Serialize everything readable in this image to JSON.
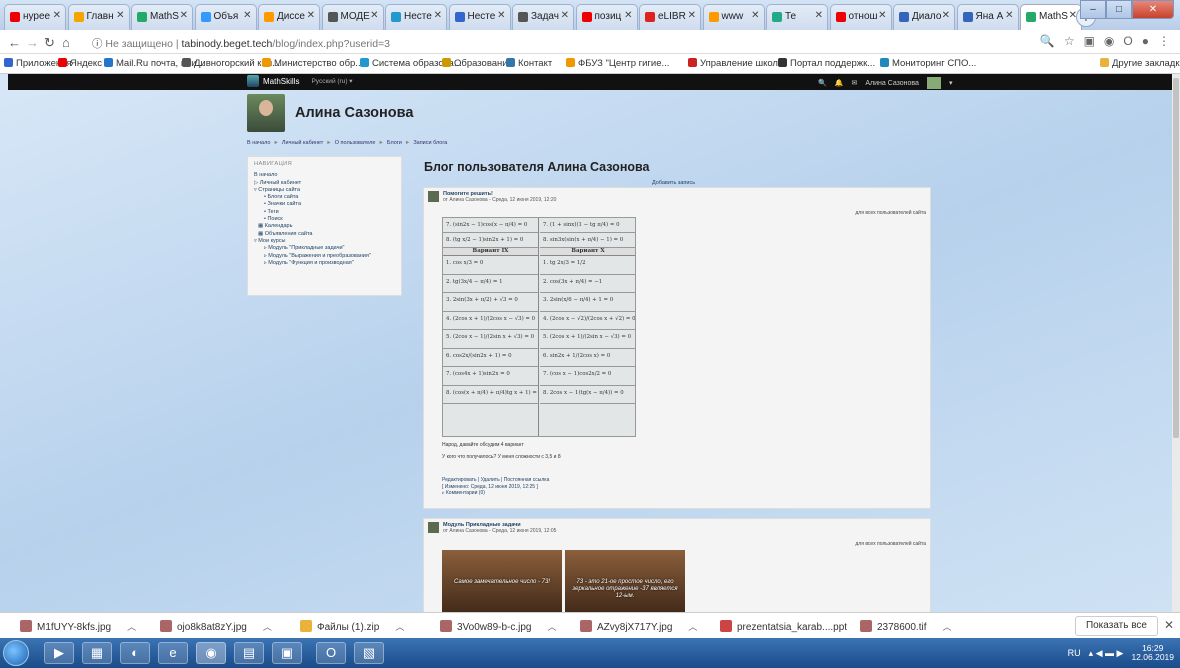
{
  "browser": {
    "tabs": [
      {
        "label": "нурее",
        "color": "#e00"
      },
      {
        "label": "Главн",
        "color": "#f5a500"
      },
      {
        "label": "MathS",
        "color": "#2a6"
      },
      {
        "label": "Объя",
        "color": "#39f"
      },
      {
        "label": "Диссе",
        "color": "#f90"
      },
      {
        "label": "МОДЕ",
        "color": "#555"
      },
      {
        "label": "Несте",
        "color": "#29c"
      },
      {
        "label": "Несте",
        "color": "#36c"
      },
      {
        "label": "Задач",
        "color": "#555"
      },
      {
        "label": "позиц",
        "color": "#e00"
      },
      {
        "label": "eLIBR",
        "color": "#d22"
      },
      {
        "label": "www",
        "color": "#f90"
      },
      {
        "label": "Те",
        "color": "#2a8"
      },
      {
        "label": "отнош",
        "color": "#e00"
      },
      {
        "label": "Диало",
        "color": "#36b"
      },
      {
        "label": "Яна А",
        "color": "#36b"
      },
      {
        "label": "MathS",
        "color": "#2a6"
      }
    ],
    "new_tab": "+",
    "url_prefix": "Не защищено",
    "url_host": "tabinody.beget.tech",
    "url_path": "/blog/index.php?userid=3",
    "bookmarks": [
      {
        "label": "Приложения",
        "color": "#36c"
      },
      {
        "label": "Яндекс",
        "color": "#e00"
      },
      {
        "label": "Mail.Ru почта, пои...",
        "color": "#27c"
      },
      {
        "label": "Дивногорский кол...",
        "color": "#555"
      },
      {
        "label": "Министерство обр...",
        "color": "#e90"
      },
      {
        "label": "Система образова...",
        "color": "#29c"
      },
      {
        "label": "Образование",
        "color": "#c90"
      },
      {
        "label": "Контакт",
        "color": "#37a"
      },
      {
        "label": "ФБУЗ \"Центр гигие...",
        "color": "#e90"
      },
      {
        "label": "Управление школ...",
        "color": "#c22"
      },
      {
        "label": "Портал поддержк...",
        "color": "#333"
      },
      {
        "label": "Мониторинг СПО...",
        "color": "#28b"
      }
    ],
    "other_bookmarks": "Другие закладки"
  },
  "moodle": {
    "brand": "MathSkills",
    "lang": "Русский (ru) ▾",
    "user_menu": "Алина Сазонова",
    "user_name": "Алина Сазонова",
    "breadcrumbs": [
      "В начало",
      "Личный кабинет",
      "О пользователе",
      "Блоги",
      "Записи блога"
    ],
    "nav_title": "НАВИГАЦИЯ",
    "nav_items": [
      {
        "label": "В начало",
        "level": 1
      },
      {
        "label": "▷ Личный кабинет",
        "level": 1
      },
      {
        "label": "▿ Страницы сайта",
        "level": 1
      },
      {
        "label": "• Блоги сайта",
        "level": 3
      },
      {
        "label": "• Значки сайта",
        "level": 3
      },
      {
        "label": "• Теги",
        "level": 3
      },
      {
        "label": "• Поиск",
        "level": 3
      },
      {
        "label": "▦ Календарь",
        "level": 2
      },
      {
        "label": "▦ Объявления сайта",
        "level": 2
      },
      {
        "label": "▿ Мои курсы",
        "level": 1
      },
      {
        "label": "▹ Модуль \"Прикладные задачи\"",
        "level": 3
      },
      {
        "label": "▹ Модуль \"Выражения и преобразования\"",
        "level": 3
      },
      {
        "label": "▹ Модуль \"Функция и производная\"",
        "level": 3
      }
    ],
    "page_title": "Блог пользователя Алина Сазонова",
    "add_entry": "Добавить запись",
    "posts": [
      {
        "title": "Помогите решить!",
        "meta": "от Алина Сазонова - Среда, 12 июня 2019, 12:20",
        "visibility": "для всех пользователей сайта",
        "text1": "Народ, давайте обсудим 4 вариант",
        "text2": "У кого что получилось? У меня сложности с 3,5 и 8",
        "actions": "Редактировать | Удалить | Постоянная ссылка",
        "edited": "[ Изменено: Среда, 12 июня 2019, 12:25 ]",
        "comments": "▹ Комментарии (0)"
      },
      {
        "title": "Модуль Прикладные задачи",
        "meta": "от Алина Сазонова - Среда, 12 июня 2019, 12:05",
        "visibility": "для всех пользователей сайта",
        "caption1": "Самое замечательное число - 73!",
        "caption2": "73 - это 21-ое простое число, его зеркальное отражение -37 является 12-ым."
      }
    ],
    "math": {
      "left": [
        "7. (sin2x − 1)cos(x − π/4) = 0",
        "8. (tg x/2 − 1)sin2x + 1) = 0",
        "Вариант IX",
        "1. cos x/3 = 0",
        "2. tg(3x/4 − π/4) = 1",
        "3. 2sin(3x + π/2) + √3 = 0",
        "4. (2cos x + 1)/(2cos x − √3) = 0",
        "5. (2cos x − 1)/(2sin x + √3) = 0",
        "6. cos2x/(sin2x + 1) = 0",
        "7. (cos4x + 1)sin2x = 0",
        "8. (cos(x + π/4) + π/4)tg x + 1) = 0"
      ],
      "right": [
        "7. (1 + sinx)(1 − tg π/4) = 0",
        "8. sin3x(sin(x + π/4) − 1) = 0",
        "Вариант X",
        "1. tg 2x/3 = 1/2",
        "2. cos(3x + π/4) = −1",
        "3. 2sin(x/6 − π/4) + 1 = 0",
        "4. (2cos x − √2)/(2cos x + √2) = 0",
        "5. (2cos x + 1)/(2sin x − √3) = 0",
        "6. sin2x + 1/(2cos x) = 0",
        "7. (cos x − 1)cos2x/2 = 0",
        "8. 2cos x − 1(tg(x − π/4)) = 0"
      ]
    }
  },
  "downloads": {
    "items": [
      {
        "name": "M1fUYY-8kfs.jpg",
        "color": "#a66"
      },
      {
        "name": "ojo8k8at8zY.jpg",
        "color": "#a66"
      },
      {
        "name": "Файлы (1).zip",
        "color": "#e9b23a"
      },
      {
        "name": "3Vo0w89-b-c.jpg",
        "color": "#a66"
      },
      {
        "name": "AZvy8jX717Y.jpg",
        "color": "#a66"
      },
      {
        "name": "prezentatsia_karab....ppt",
        "color": "#c44"
      },
      {
        "name": "2378600.tif",
        "color": "#a66"
      }
    ],
    "show_all": "Показать все"
  },
  "taskbar": {
    "lang": "RU",
    "time": "16:29",
    "date": "12.06.2019"
  }
}
